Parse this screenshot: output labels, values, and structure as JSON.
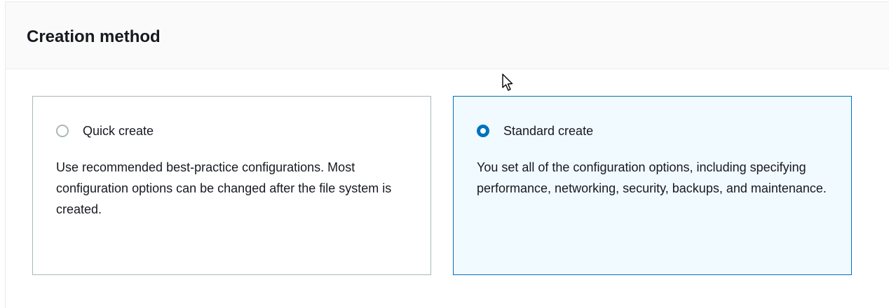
{
  "section": {
    "title": "Creation method"
  },
  "options": [
    {
      "label": "Quick create",
      "description": "Use recommended best-practice configurations. Most configuration options can be changed after the file system is created.",
      "selected": false
    },
    {
      "label": "Standard create",
      "description": "You set all of the configuration options, including specifying performance, networking, security, backups, and maintenance.",
      "selected": true
    }
  ],
  "colors": {
    "accent": "#0073bb",
    "selected_tile_bg": "#f1faff",
    "header_bg": "#fafafa",
    "text": "#16191f"
  },
  "icons": {
    "cursor": "mouse-pointer-icon"
  }
}
